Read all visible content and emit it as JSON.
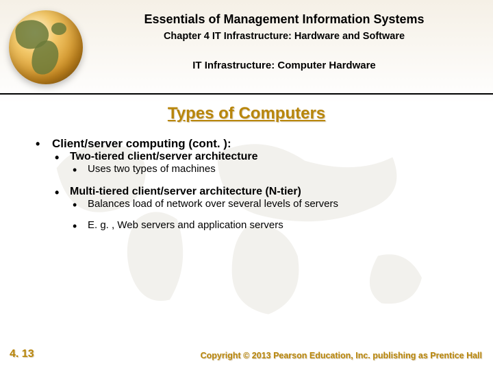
{
  "header": {
    "book_title": "Essentials of Management Information Systems",
    "chapter": "Chapter 4 IT Infrastructure: Hardware and Software",
    "section": "IT Infrastructure: Computer Hardware"
  },
  "slide_title": "Types of Computers",
  "content": {
    "heading": "Client/server computing (cont. ):",
    "items": [
      {
        "label": "Two-tiered client/server architecture",
        "bold": true,
        "children": [
          {
            "label": "Uses two types of machines",
            "bold": false
          }
        ]
      },
      {
        "label": "Multi-tiered client/server architecture (N-tier)",
        "bold": true,
        "children": [
          {
            "label": "Balances load of network over several levels of servers",
            "bold": false
          },
          {
            "label": "E. g. , Web servers and application servers",
            "bold": false
          }
        ]
      }
    ]
  },
  "footer": {
    "slide_number": "4. 13",
    "copyright": "Copyright © 2013 Pearson Education, Inc. publishing as Prentice Hall"
  }
}
